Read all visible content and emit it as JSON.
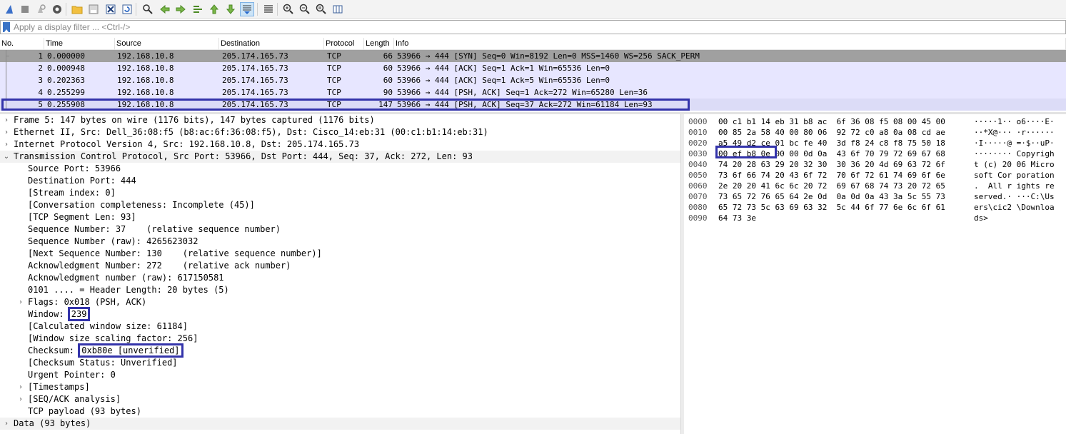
{
  "toolbar": {
    "icons": [
      "shark-fin-start-icon",
      "stop-capture-icon",
      "restart-capture-icon",
      "capture-options-icon",
      "open-file-icon",
      "save-file-icon",
      "close-file-icon",
      "reload-file-icon",
      "find-packet-icon",
      "go-back-icon",
      "go-forward-icon",
      "go-to-packet-icon",
      "go-first-icon",
      "go-last-icon",
      "autoscroll-icon",
      "colorize-icon",
      "zoom-in-icon",
      "zoom-out-icon",
      "zoom-normal-icon",
      "resize-columns-icon"
    ]
  },
  "filter": {
    "placeholder": "Apply a display filter ... <Ctrl-/>"
  },
  "packet_list": {
    "columns": [
      "No.",
      "Time",
      "Source",
      "Destination",
      "Protocol",
      "Length",
      "Info"
    ],
    "rows": [
      {
        "no": "1",
        "time": "0.000000",
        "src": "192.168.10.8",
        "dst": "205.174.165.73",
        "proto": "TCP",
        "len": "66",
        "info": "53966 → 444 [SYN] Seq=0 Win=8192 Len=0 MSS=1460 WS=256 SACK_PERM"
      },
      {
        "no": "2",
        "time": "0.000948",
        "src": "192.168.10.8",
        "dst": "205.174.165.73",
        "proto": "TCP",
        "len": "60",
        "info": "53966 → 444 [ACK] Seq=1 Ack=1 Win=65536 Len=0"
      },
      {
        "no": "3",
        "time": "0.202363",
        "src": "192.168.10.8",
        "dst": "205.174.165.73",
        "proto": "TCP",
        "len": "60",
        "info": "53966 → 444 [ACK] Seq=1 Ack=5 Win=65536 Len=0"
      },
      {
        "no": "4",
        "time": "0.255299",
        "src": "192.168.10.8",
        "dst": "205.174.165.73",
        "proto": "TCP",
        "len": "90",
        "info": "53966 → 444 [PSH, ACK] Seq=1 Ack=272 Win=65280 Len=36"
      },
      {
        "no": "5",
        "time": "0.255908",
        "src": "192.168.10.8",
        "dst": "205.174.165.73",
        "proto": "TCP",
        "len": "147",
        "info": "53966 → 444 [PSH, ACK] Seq=37 Ack=272 Win=61184 Len=93"
      }
    ]
  },
  "details": {
    "lines": [
      {
        "text": "Frame 5: 147 bytes on wire (1176 bits), 147 bytes captured (1176 bits)",
        "arrow": "collapsed",
        "indent": 0
      },
      {
        "text": "Ethernet II, Src: Dell_36:08:f5 (b8:ac:6f:36:08:f5), Dst: Cisco_14:eb:31 (00:c1:b1:14:eb:31)",
        "arrow": "collapsed",
        "indent": 0
      },
      {
        "text": "Internet Protocol Version 4, Src: 192.168.10.8, Dst: 205.174.165.73",
        "arrow": "collapsed",
        "indent": 0
      },
      {
        "text": "Transmission Control Protocol, Src Port: 53966, Dst Port: 444, Seq: 37, Ack: 272, Len: 93",
        "arrow": "expanded",
        "indent": 0
      },
      {
        "text": "Source Port: 53966",
        "arrow": "",
        "indent": 1
      },
      {
        "text": "Destination Port: 444",
        "arrow": "",
        "indent": 1
      },
      {
        "text": "[Stream index: 0]",
        "arrow": "",
        "indent": 1
      },
      {
        "text": "[Conversation completeness: Incomplete (45)]",
        "arrow": "",
        "indent": 1
      },
      {
        "text": "[TCP Segment Len: 93]",
        "arrow": "",
        "indent": 1
      },
      {
        "text": "Sequence Number: 37    (relative sequence number)",
        "arrow": "",
        "indent": 1
      },
      {
        "text": "Sequence Number (raw): 4265623032",
        "arrow": "",
        "indent": 1
      },
      {
        "text": "[Next Sequence Number: 130    (relative sequence number)]",
        "arrow": "",
        "indent": 1
      },
      {
        "text": "Acknowledgment Number: 272    (relative ack number)",
        "arrow": "",
        "indent": 1
      },
      {
        "text": "Acknowledgment number (raw): 617150581",
        "arrow": "",
        "indent": 1
      },
      {
        "text": "0101 .... = Header Length: 20 bytes (5)",
        "arrow": "",
        "indent": 1
      },
      {
        "text": "Flags: 0x018 (PSH, ACK)",
        "arrow": "collapsed",
        "indent": 1
      },
      {
        "text": "Window: ",
        "boxed": "239",
        "arrow": "",
        "indent": 1
      },
      {
        "text": "[Calculated window size: 61184]",
        "arrow": "",
        "indent": 1
      },
      {
        "text": "[Window size scaling factor: 256]",
        "arrow": "",
        "indent": 1
      },
      {
        "text": "Checksum: ",
        "boxed": "0xb80e [unverified]",
        "arrow": "",
        "indent": 1
      },
      {
        "text": "[Checksum Status: Unverified]",
        "arrow": "",
        "indent": 1
      },
      {
        "text": "Urgent Pointer: 0",
        "arrow": "",
        "indent": 1
      },
      {
        "text": "[Timestamps]",
        "arrow": "collapsed",
        "indent": 1
      },
      {
        "text": "[SEQ/ACK analysis]",
        "arrow": "collapsed",
        "indent": 1
      },
      {
        "text": "TCP payload (93 bytes)",
        "arrow": "",
        "indent": 1
      },
      {
        "text": "Data (93 bytes)",
        "arrow": "collapsed",
        "indent": 0
      }
    ]
  },
  "bytes": {
    "lines": [
      {
        "off": "0000",
        "hex": "00 c1 b1 14 eb 31 b8 ac  6f 36 08 f5 08 00 45 00",
        "ascii": "·····1·· o6····E·"
      },
      {
        "off": "0010",
        "hex": "00 85 2a 58 40 00 80 06  92 72 c0 a8 0a 08 cd ae",
        "ascii": "··*X@··· ·r······"
      },
      {
        "off": "0020",
        "hex": "a5 49 d2 ce 01 bc fe 40  3d f8 24 c8 f8 75 50 18",
        "ascii": "·I·····@ =·$··uP·"
      },
      {
        "off": "0030",
        "hex": "00 ef b8 0e 00 00 0d 0a  43 6f 70 79 72 69 67 68",
        "ascii": "········ Copyrigh"
      },
      {
        "off": "0040",
        "hex": "74 20 28 63 29 20 32 30  30 36 20 4d 69 63 72 6f",
        "ascii": "t (c) 20 06 Micro"
      },
      {
        "off": "0050",
        "hex": "73 6f 66 74 20 43 6f 72  70 6f 72 61 74 69 6f 6e",
        "ascii": "soft Cor poration"
      },
      {
        "off": "0060",
        "hex": "2e 20 20 41 6c 6c 20 72  69 67 68 74 73 20 72 65",
        "ascii": ".  All r ights re"
      },
      {
        "off": "0070",
        "hex": "73 65 72 76 65 64 2e 0d  0a 0d 0a 43 3a 5c 55 73",
        "ascii": "served.· ···C:\\Us"
      },
      {
        "off": "0080",
        "hex": "65 72 73 5c 63 69 63 32  5c 44 6f 77 6e 6c 6f 61",
        "ascii": "ers\\cic2 \\Downloa"
      },
      {
        "off": "0090",
        "hex": "64 73 3e",
        "ascii": "ds>"
      }
    ]
  }
}
